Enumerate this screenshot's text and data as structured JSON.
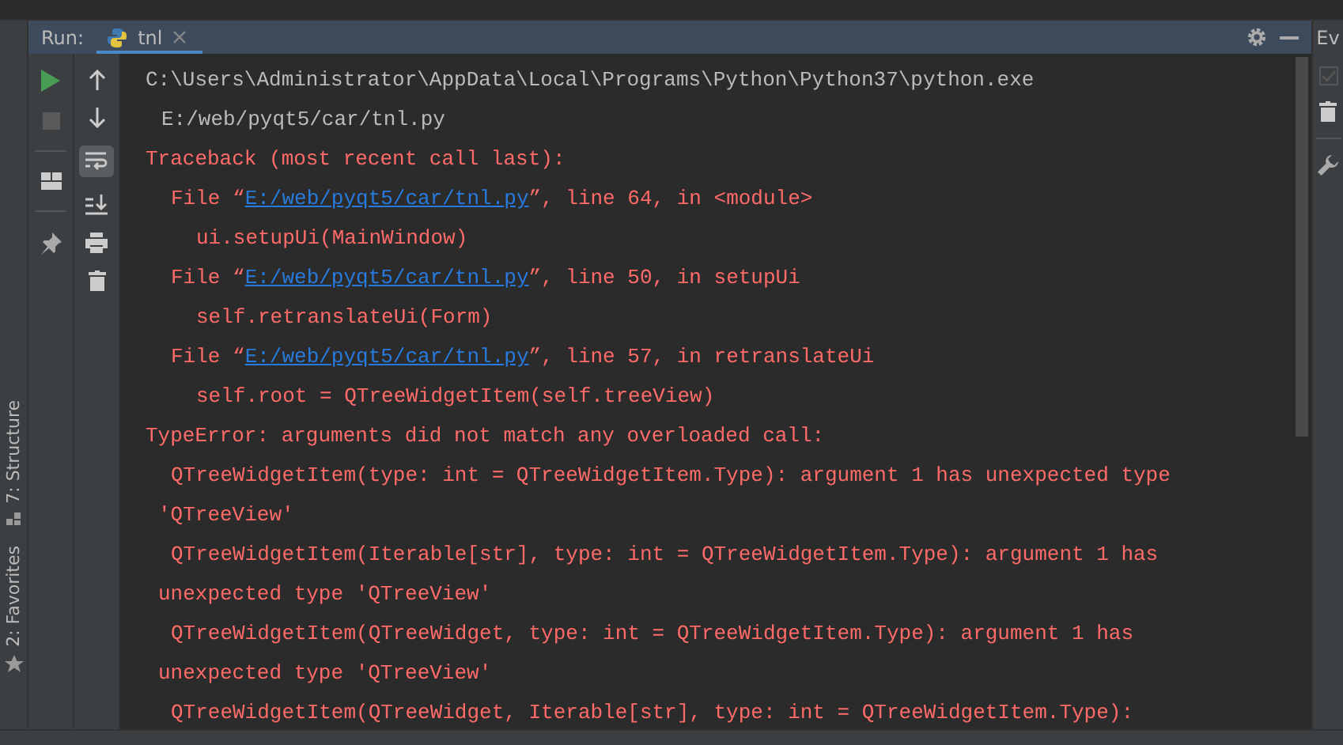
{
  "run_panel": {
    "label": "Run:",
    "tab": {
      "title": "tnl",
      "selected": true
    }
  },
  "console_toolbar": {
    "soft_wrap_on": true
  },
  "side_tools": [
    {
      "label": "7: Structure"
    },
    {
      "label": "2: Favorites"
    }
  ],
  "right_panel": {
    "title": "Ev"
  },
  "console_lines": [
    {
      "kind": "plain",
      "text": "C:\\Users\\Administrator\\AppData\\Local\\Programs\\Python\\Python37\\python.exe"
    },
    {
      "kind": "plain-cont",
      "text": "E:/web/pyqt5/car/tnl.py"
    },
    {
      "kind": "error",
      "text": "Traceback (most recent call last):"
    },
    {
      "kind": "file",
      "prefix": "File “",
      "link": "E:/web/pyqt5/car/tnl.py",
      "suffix": "”, line 64, in <module>"
    },
    {
      "kind": "code",
      "text": "ui.setupUi(MainWindow)"
    },
    {
      "kind": "file",
      "prefix": "File “",
      "link": "E:/web/pyqt5/car/tnl.py",
      "suffix": "”, line 50, in setupUi"
    },
    {
      "kind": "code",
      "text": "self.retranslateUi(Form)"
    },
    {
      "kind": "file",
      "prefix": "File “",
      "link": "E:/web/pyqt5/car/tnl.py",
      "suffix": "”, line 57, in retranslateUi"
    },
    {
      "kind": "code",
      "text": "self.root = QTreeWidgetItem(self.treeView)"
    },
    {
      "kind": "error",
      "text": "TypeError: arguments did not match any overloaded call:"
    },
    {
      "kind": "detail",
      "text": "QTreeWidgetItem(type: int = QTreeWidgetItem.Type): argument 1 has unexpected type"
    },
    {
      "kind": "detail-cont",
      "text": "'QTreeView'"
    },
    {
      "kind": "detail",
      "text": "QTreeWidgetItem(Iterable[str], type: int = QTreeWidgetItem.Type): argument 1 has"
    },
    {
      "kind": "detail-cont",
      "text": "unexpected type 'QTreeView'"
    },
    {
      "kind": "detail",
      "text": "QTreeWidgetItem(QTreeWidget, type: int = QTreeWidgetItem.Type): argument 1 has"
    },
    {
      "kind": "detail-cont",
      "text": "unexpected type 'QTreeView'"
    },
    {
      "kind": "detail",
      "text": "QTreeWidgetItem(QTreeWidget, Iterable[str], type: int = QTreeWidgetItem.Type):"
    }
  ]
}
